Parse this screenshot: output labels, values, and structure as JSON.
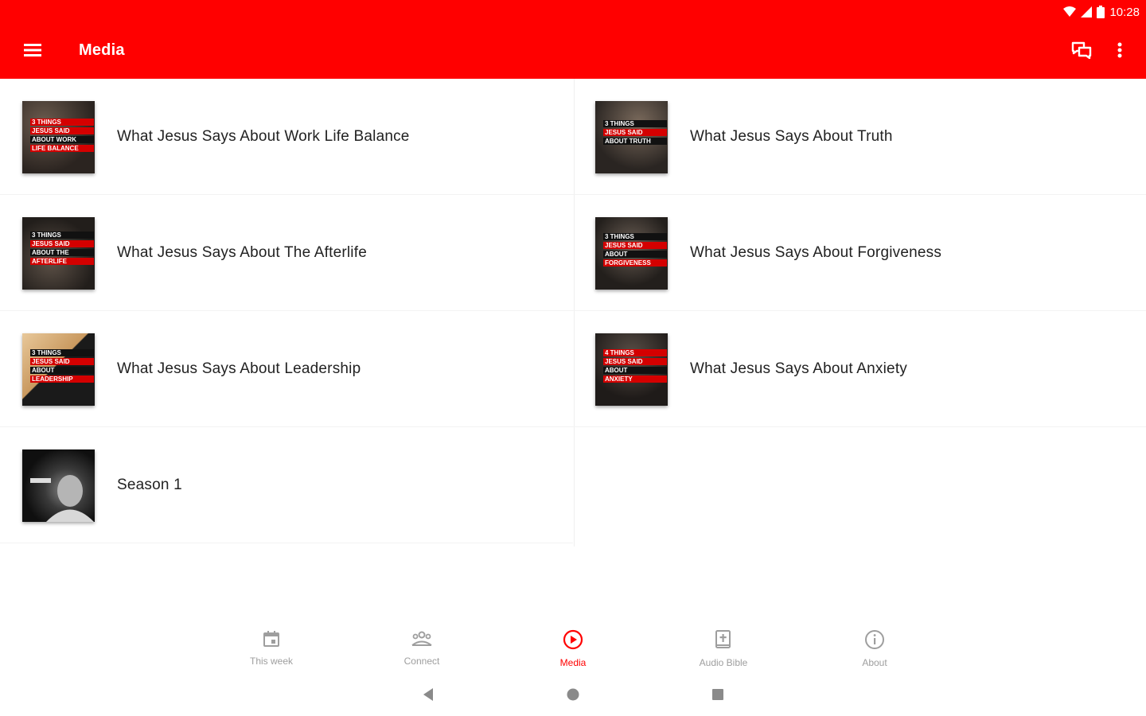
{
  "status": {
    "time": "10:28"
  },
  "app_bar": {
    "title": "Media",
    "background": "#ff0000",
    "icons": [
      "menu-icon",
      "chat-icon",
      "more-vert-icon"
    ]
  },
  "media_items": [
    {
      "title": "What Jesus Says About Work Life Balance",
      "thumb_lines": [
        "3 THINGS",
        "JESUS SAID",
        "ABOUT WORK",
        "LIFE BALANCE"
      ]
    },
    {
      "title": "What Jesus Says About Truth",
      "thumb_lines": [
        "3 THINGS",
        "JESUS SAID",
        "ABOUT TRUTH"
      ]
    },
    {
      "title": "What Jesus Says About The Afterlife",
      "thumb_lines": [
        "3 THINGS",
        "JESUS SAID",
        "ABOUT THE",
        "AFTERLIFE"
      ]
    },
    {
      "title": "What Jesus Says About Forgiveness",
      "thumb_lines": [
        "3 THINGS",
        "JESUS SAID",
        "ABOUT",
        "FORGIVENESS"
      ]
    },
    {
      "title": "What Jesus Says About Leadership",
      "thumb_lines": [
        "3 THINGS",
        "JESUS SAID",
        "ABOUT",
        "LEADERSHIP"
      ]
    },
    {
      "title": "What Jesus Says About Anxiety",
      "thumb_lines": [
        "4 THINGS",
        "JESUS SAID",
        "ABOUT",
        "ANXIETY"
      ]
    },
    {
      "title": "Season 1",
      "thumb_lines": []
    }
  ],
  "bottom_nav": {
    "items": [
      {
        "label": "This week",
        "icon": "calendar-icon",
        "active": false
      },
      {
        "label": "Connect",
        "icon": "people-icon",
        "active": false
      },
      {
        "label": "Media",
        "icon": "play-circle-icon",
        "active": true
      },
      {
        "label": "Audio Bible",
        "icon": "bible-icon",
        "active": false
      },
      {
        "label": "About",
        "icon": "info-icon",
        "active": false
      }
    ],
    "active_color": "#ff0000",
    "inactive_color": "#9e9e9e"
  },
  "system_nav": {
    "icons": [
      "back-icon",
      "home-icon",
      "recents-icon"
    ]
  }
}
